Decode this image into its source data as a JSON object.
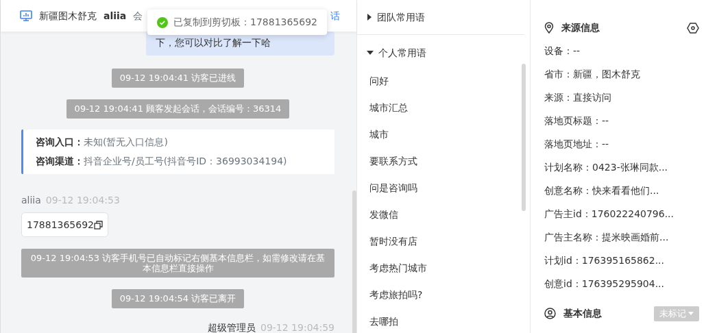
{
  "header": {
    "location": "新疆图木舒克",
    "agent": "aliia",
    "partial_text": "会",
    "link": "话"
  },
  "toast": {
    "message": "已复制到剪切板：17881365692"
  },
  "messages": [
    {
      "kind": "bubble",
      "text": "下，您可以对比了解一下哈"
    },
    {
      "kind": "system",
      "text": "09-12 19:04:41 访客已进线"
    },
    {
      "kind": "system",
      "text": "09-12 19:04:41 顾客发起会话，会话编号：36314"
    },
    {
      "kind": "info",
      "rows": [
        {
          "label": "咨询入口：",
          "value": "未知(暂无入口信息)"
        },
        {
          "label": "咨询渠道：",
          "value": "抖音企业号/员工号(抖音号ID：36993034194)"
        }
      ]
    },
    {
      "kind": "visitor",
      "sender": "aliia",
      "time": "09-12 19:04:53",
      "text": "17881365692"
    },
    {
      "kind": "system",
      "text": "09-12 19:04:53 访客手机号已自动标记右侧基本信息栏，如需修改请在基本信息栏直接操作"
    },
    {
      "kind": "system",
      "text": "09-12 19:04:54 访客已离开"
    },
    {
      "kind": "agent",
      "sender": "超级管理员",
      "time": "09-12 19:04:59"
    }
  ],
  "phrases": {
    "groups": [
      {
        "title": "团队常用语",
        "expanded": false
      },
      {
        "title": "个人常用语",
        "expanded": true,
        "items": [
          "问好",
          "城市汇总",
          "城市",
          "要联系方式",
          "问是咨询吗",
          "发微信",
          "暂时没有店",
          "考虑热门城市",
          "考虑旅拍吗?",
          "去哪拍"
        ]
      }
    ]
  },
  "source_info": {
    "title": "来源信息",
    "rows": [
      "设备：--",
      "省市：新疆，图木舒克",
      "来源：直接访问",
      "落地页标题：--",
      "落地页地址：--",
      "计划名称：0423-张琳同款...",
      "创意名称：快来看看他们...",
      "广告主id：176022240796...",
      "广告主名称：提米映画婚前...",
      "计划id：176395165862...",
      "创意id：176395295904..."
    ]
  },
  "basic_info": {
    "title": "基本信息",
    "tag": "未标记"
  }
}
